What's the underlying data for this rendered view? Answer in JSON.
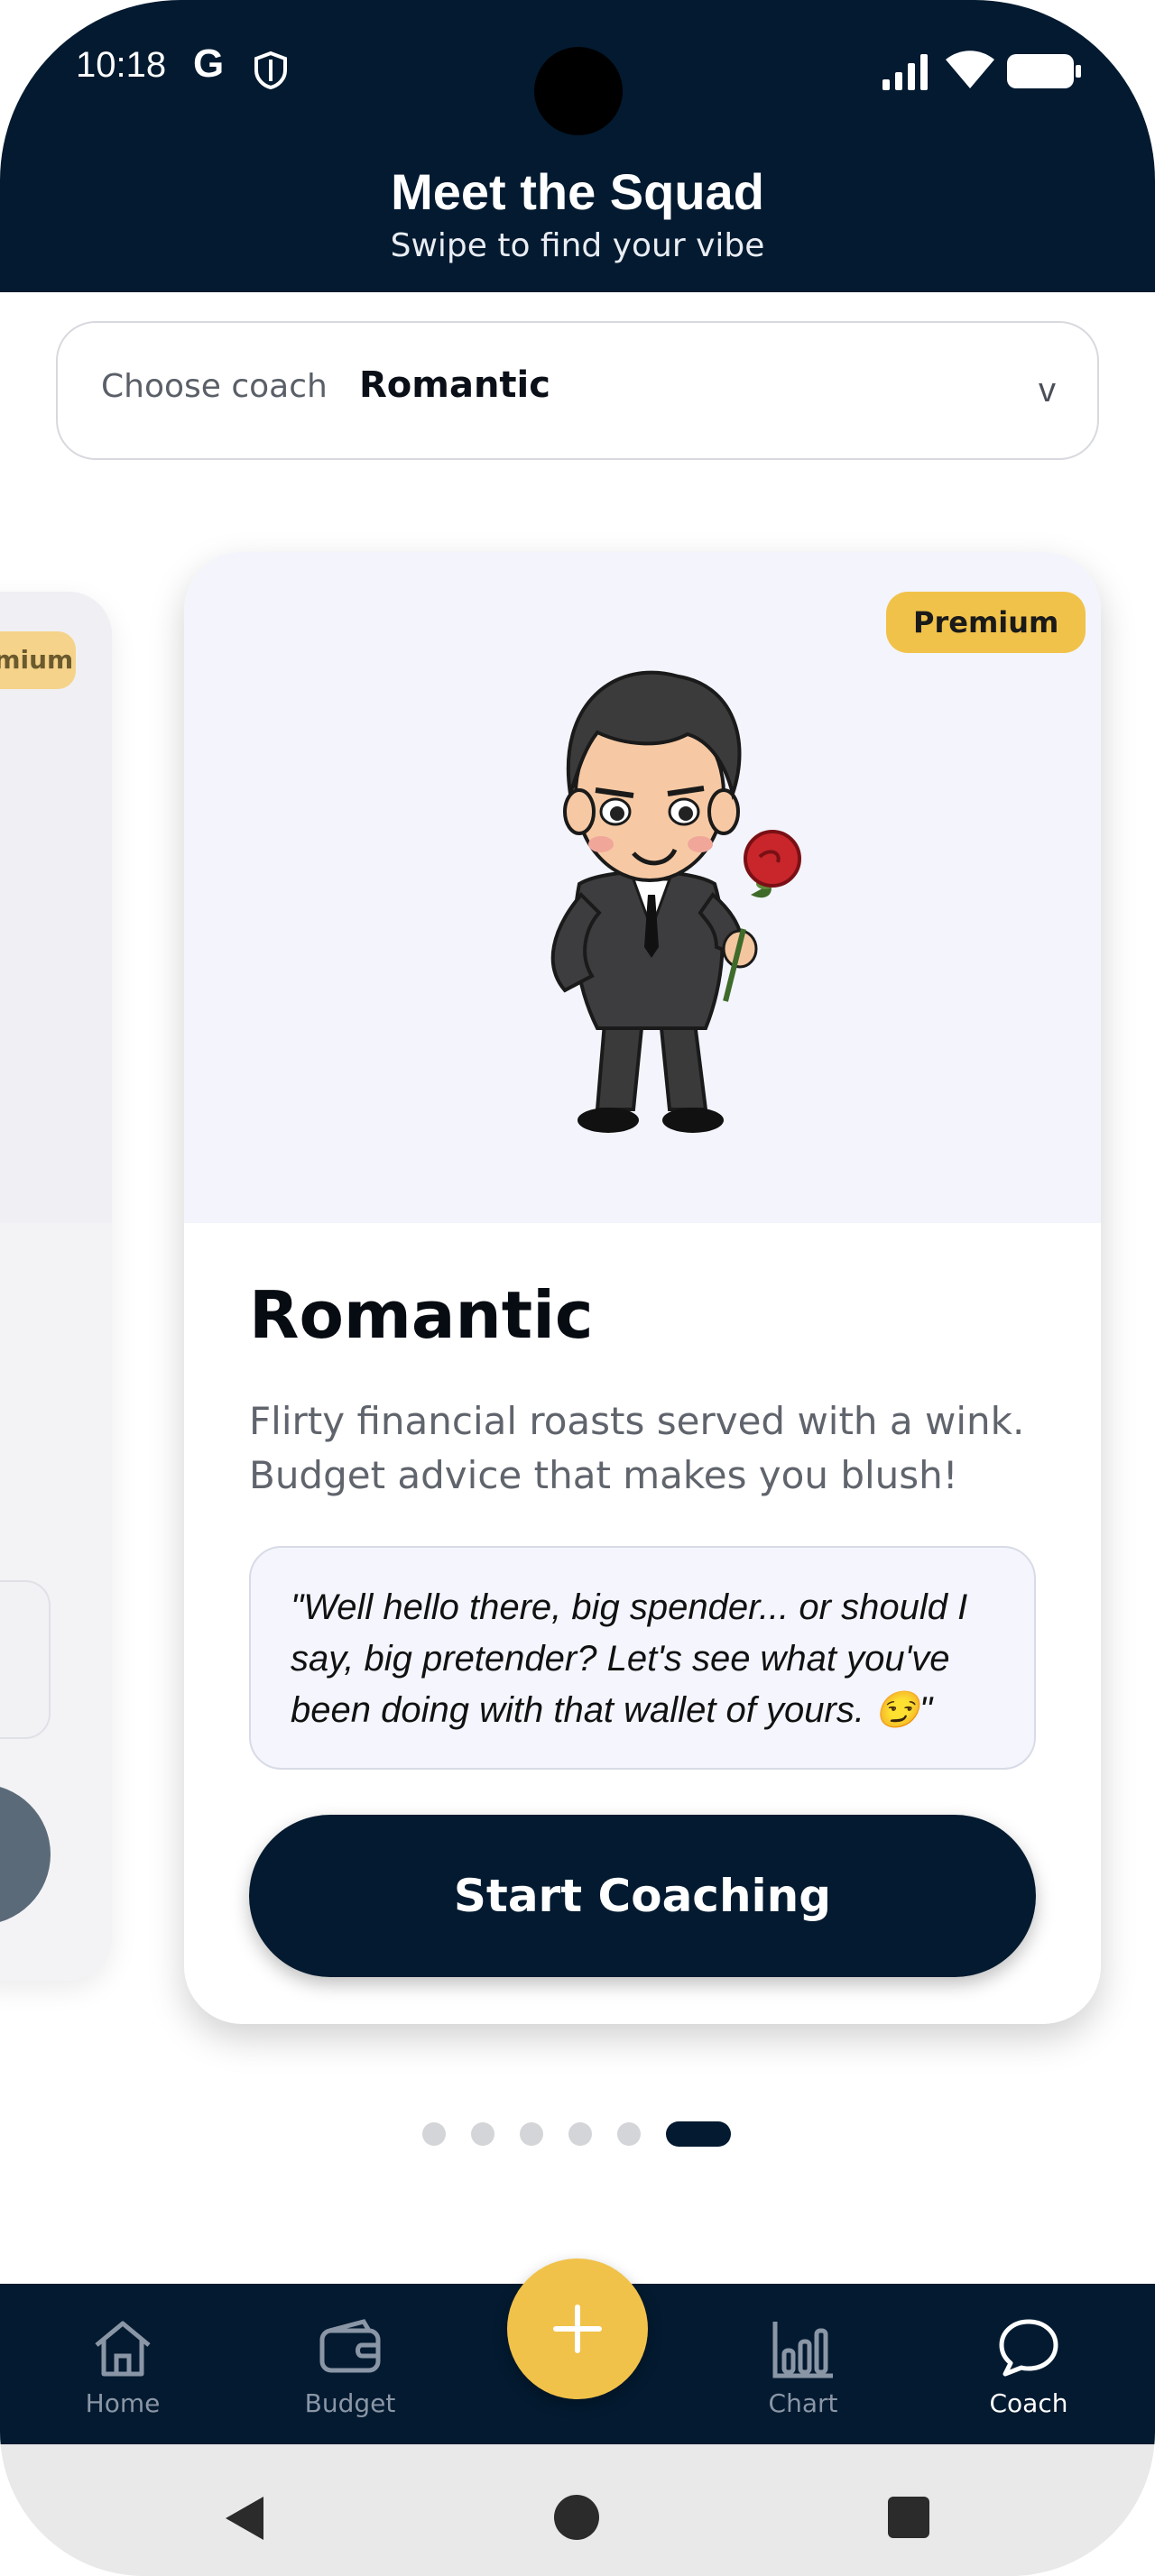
{
  "status_bar": {
    "time": "10:18",
    "g_label": "G"
  },
  "header": {
    "title": "Meet the Squad",
    "subtitle": "Swipe to find your vibe"
  },
  "selector": {
    "label": "Choose coach",
    "value": "Romantic",
    "chevron": "v"
  },
  "prev_card": {
    "badge": "Premium"
  },
  "card": {
    "badge": "Premium",
    "name": "Romantic",
    "description": "Flirty financial roasts served with a wink. Budget advice that makes you blush!",
    "quote": "\"Well hello there, big spender... or should I say, big pretender? Let's see what you've been doing with that wallet of yours. 😏\"",
    "cta": "Start Coaching"
  },
  "pager": {
    "total": 6,
    "active_index": 5
  },
  "bottom_nav": {
    "items": [
      {
        "label": "Home",
        "icon": "home-icon"
      },
      {
        "label": "Budget",
        "icon": "wallet-icon"
      },
      {
        "label": "Chart",
        "icon": "bar-chart-icon"
      },
      {
        "label": "Coach",
        "icon": "chat-bubble-icon"
      }
    ],
    "active": "Coach",
    "fab_icon": "plus-icon"
  },
  "colors": {
    "navy": "#031a30",
    "accent_yellow": "#f1c24a",
    "card_hero_bg": "#f3f4fc"
  }
}
